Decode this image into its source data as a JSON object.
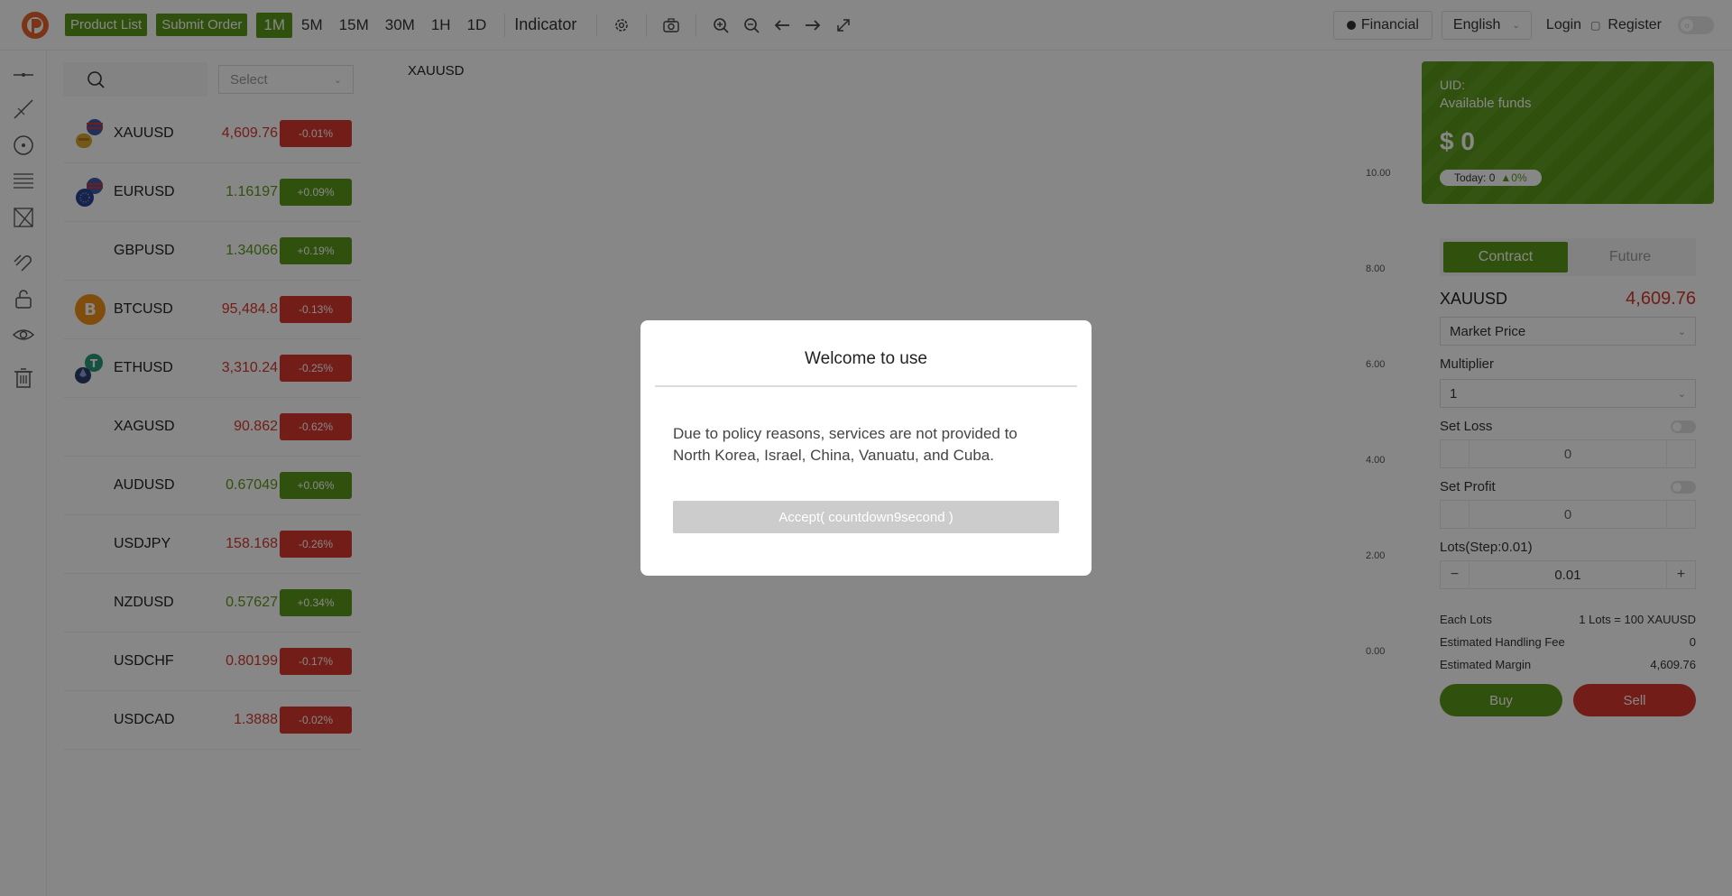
{
  "topbar": {
    "product_list": "Product List",
    "submit_order": "Submit Order",
    "timeframes": [
      "1M",
      "5M",
      "15M",
      "30M",
      "1H",
      "1D"
    ],
    "active_timeframe": "1M",
    "indicator": "Indicator",
    "financial": "Financial",
    "language": "English",
    "login": "Login",
    "register": "Register"
  },
  "product_list": {
    "select_placeholder": "Select",
    "items": [
      {
        "symbol": "XAUUSD",
        "price": "4,609.76",
        "change": "-0.01%",
        "dir": "down",
        "icon": "gold-usd-flag-icon"
      },
      {
        "symbol": "EURUSD",
        "price": "1.16197",
        "change": "+0.09%",
        "dir": "up",
        "icon": "eu-us-flag-icon"
      },
      {
        "symbol": "GBPUSD",
        "price": "1.34066",
        "change": "+0.19%",
        "dir": "up",
        "icon": ""
      },
      {
        "symbol": "BTCUSD",
        "price": "95,484.8",
        "change": "-0.13%",
        "dir": "down",
        "icon": "bitcoin-icon"
      },
      {
        "symbol": "ETHUSD",
        "price": "3,310.24",
        "change": "-0.25%",
        "dir": "down",
        "icon": "tether-ethereum-icon"
      },
      {
        "symbol": "XAGUSD",
        "price": "90.862",
        "change": "-0.62%",
        "dir": "down",
        "icon": ""
      },
      {
        "symbol": "AUDUSD",
        "price": "0.67049",
        "change": "+0.06%",
        "dir": "up",
        "icon": ""
      },
      {
        "symbol": "USDJPY",
        "price": "158.168",
        "change": "-0.26%",
        "dir": "down",
        "icon": ""
      },
      {
        "symbol": "NZDUSD",
        "price": "0.57627",
        "change": "+0.34%",
        "dir": "up",
        "icon": ""
      },
      {
        "symbol": "USDCHF",
        "price": "0.80199",
        "change": "-0.17%",
        "dir": "down",
        "icon": ""
      },
      {
        "symbol": "USDCAD",
        "price": "1.3888",
        "change": "-0.02%",
        "dir": "down",
        "icon": ""
      }
    ]
  },
  "chart": {
    "symbol": "XAUUSD",
    "yticks": [
      "10.00",
      "8.00",
      "6.00",
      "4.00",
      "2.00",
      "0.00"
    ]
  },
  "account": {
    "uid_label": "UID:",
    "available_funds_label": "Available funds",
    "amount": "$ 0",
    "today": "Today: 0",
    "today_change": "0%"
  },
  "order": {
    "tab_contract": "Contract",
    "tab_future": "Future",
    "symbol": "XAUUSD",
    "price": "4,609.76",
    "price_type": "Market Price",
    "multiplier_label": "Multiplier",
    "multiplier_value": "1",
    "set_loss_label": "Set Loss",
    "set_loss_value": "0",
    "set_profit_label": "Set Profit",
    "set_profit_value": "0",
    "lots_label": "Lots(Step:0.01)",
    "lots_value": "0.01",
    "each_lots_label": "Each Lots",
    "each_lots_value": "1 Lots = 100 XAUUSD",
    "fee_label": "Estimated Handling Fee",
    "fee_value": "0",
    "margin_label": "Estimated Margin",
    "margin_value": "4,609.76",
    "buy": "Buy",
    "sell": "Sell"
  },
  "modal": {
    "title": "Welcome to use",
    "body": "Due to policy reasons, services are not provided to North Korea, Israel, China, Vanuatu, and Cuba.",
    "accept": "Accept( countdown9second )"
  },
  "colors": {
    "brand_green": "#5b9a1a",
    "down_red": "#d7372c"
  }
}
